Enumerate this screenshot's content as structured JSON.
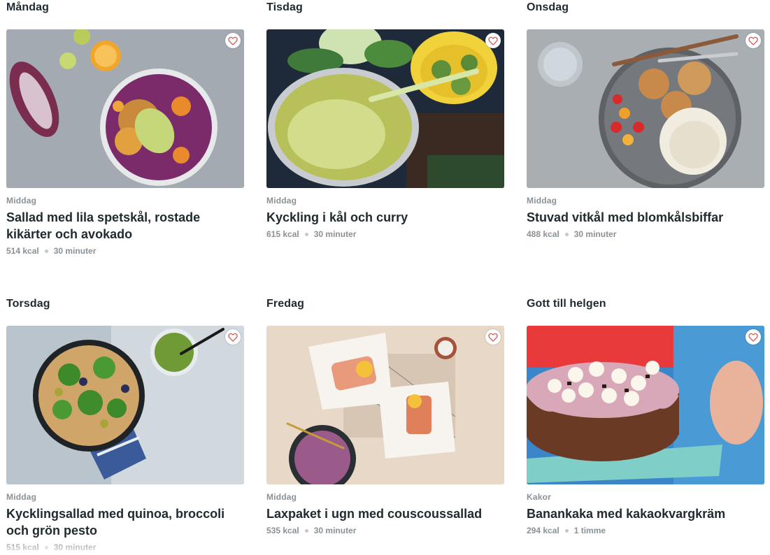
{
  "recipes": [
    {
      "day": "Måndag",
      "category": "Middag",
      "title": "Sallad med lila spetskål, rostade kikärter och avokado",
      "kcal": "514 kcal",
      "time": "30 minuter",
      "favorite_icon": "heart-outline-icon"
    },
    {
      "day": "Tisdag",
      "category": "Middag",
      "title": "Kyckling i kål och curry",
      "kcal": "615 kcal",
      "time": "30 minuter",
      "favorite_icon": "heart-outline-icon"
    },
    {
      "day": "Onsdag",
      "category": "Middag",
      "title": "Stuvad vitkål med blomkålsbiffar",
      "kcal": "488 kcal",
      "time": "30 minuter",
      "favorite_icon": "heart-outline-icon"
    },
    {
      "day": "Torsdag",
      "category": "Middag",
      "title": "Kycklingsallad med quinoa, broccoli och grön pesto",
      "kcal": "515 kcal",
      "time": "30 minuter",
      "favorite_icon": "heart-outline-icon"
    },
    {
      "day": "Fredag",
      "category": "Middag",
      "title": "Laxpaket i ugn med couscoussallad",
      "kcal": "535 kcal",
      "time": "30 minuter",
      "favorite_icon": "heart-outline-icon"
    },
    {
      "day": "Gott till helgen",
      "category": "Kakor",
      "title": "Banankaka med kakaokvargkräm",
      "kcal": "294 kcal",
      "time": "1 timme",
      "favorite_icon": "heart-outline-icon"
    }
  ],
  "colors": {
    "heart": "#d9534f",
    "text": "#1f2a2e",
    "muted": "#8a9196"
  }
}
